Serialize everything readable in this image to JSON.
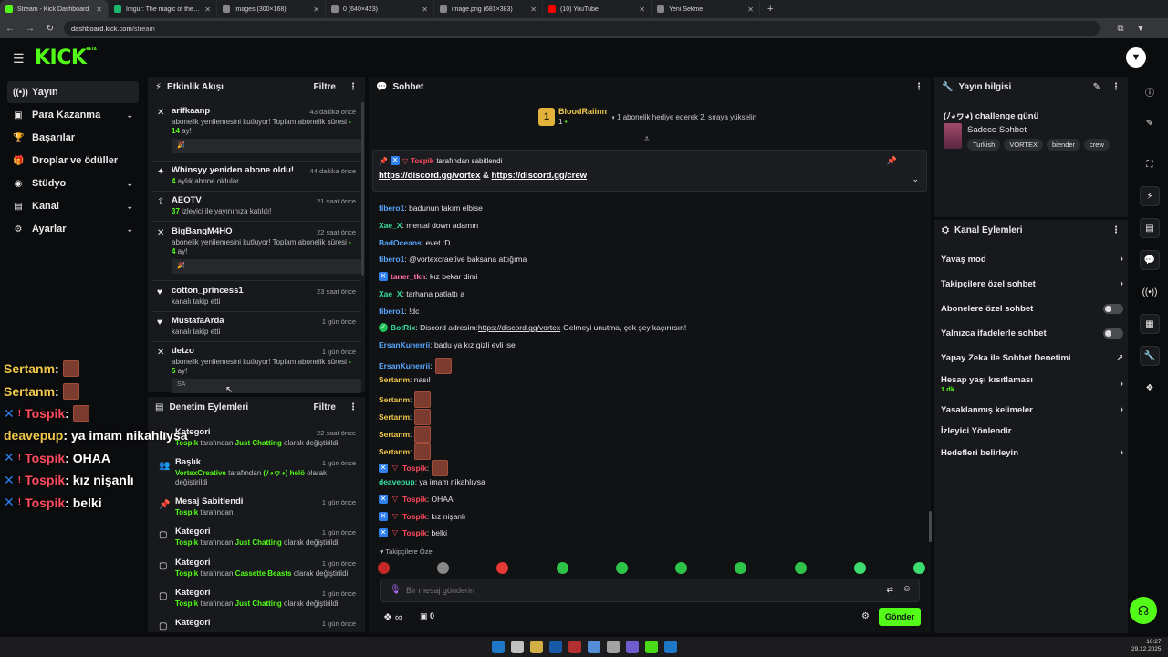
{
  "browser": {
    "tabs": [
      {
        "title": "Stream - Kick Dashboard",
        "color": "#53fc18",
        "active": true
      },
      {
        "title": "Imgur: The magic of the Internet",
        "color": "#1bb76e"
      },
      {
        "title": "images (300×168)",
        "color": "#888"
      },
      {
        "title": "0 (640×423)",
        "color": "#888"
      },
      {
        "title": "image.png (681×383)",
        "color": "#888"
      },
      {
        "title": "(10) YouTube",
        "color": "#ff0000"
      },
      {
        "title": "Yeni Sekme",
        "color": "#888"
      }
    ],
    "new_tab": "+",
    "url_host": "dashboard.kick.com",
    "url_path": "/stream"
  },
  "header": {
    "logo": "KICK",
    "logo_sup": "BETA"
  },
  "sidebar": {
    "items": [
      {
        "label": "Yayın",
        "icon": "broadcast-icon",
        "glyph": "((•))",
        "active": true
      },
      {
        "label": "Para Kazanma",
        "icon": "wallet-icon",
        "glyph": "▣",
        "chev": true
      },
      {
        "label": "Başarılar",
        "icon": "trophy-icon",
        "glyph": "🏆"
      },
      {
        "label": "Droplar ve ödüller",
        "icon": "gift-icon",
        "glyph": "🎁"
      },
      {
        "label": "Stüdyo",
        "icon": "studio-icon",
        "glyph": "◉",
        "chev": true
      },
      {
        "label": "Kanal",
        "icon": "channel-icon",
        "glyph": "▤",
        "chev": true
      },
      {
        "label": "Ayarlar",
        "icon": "gear-icon",
        "glyph": "⚙",
        "chev": true
      }
    ]
  },
  "activity": {
    "title": "Etkinlik Akışı",
    "filter": "Filtre",
    "events": [
      {
        "name": "arifkaanp",
        "time": "43 dakika önce",
        "text": "abonelik yenilemesini kutluyor! Toplam abonelik süresi",
        "hl": "- 14",
        "tail": " ay!",
        "quote": "🎉",
        "icon": "renew-icon",
        "g": "✕"
      },
      {
        "name": "Whinsyy yeniden abone oldu!",
        "time": "44 dakika önce",
        "hl": "4",
        "text": " aylık abone oldular",
        "icon": "sparkle-icon",
        "g": "✦"
      },
      {
        "name": "AEOTV",
        "time": "21 saat önce",
        "hl": "37",
        "text": " izleyici ile yayınınıza katıldı!",
        "icon": "raid-icon",
        "g": "⇪"
      },
      {
        "name": "BigBangM4HO",
        "time": "22 saat önce",
        "text": "abonelik yenilemesini kutluyor! Toplam abonelik süresi",
        "hl": "- 4",
        "tail": " ay!",
        "quote": "🎉",
        "icon": "renew-icon",
        "g": "✕"
      },
      {
        "name": "cotton_princess1",
        "time": "23 saat önce",
        "text": "kanalı takip etti",
        "icon": "heart-icon",
        "g": "♥"
      },
      {
        "name": "MustafaArda",
        "time": "1 gün önce",
        "text": "kanalı takip etti",
        "icon": "heart-icon",
        "g": "♥"
      },
      {
        "name": "detzo",
        "time": "1 gün önce",
        "text": "abonelik yenilemesini kutluyor! Toplam abonelik süresi",
        "hl": "- 5",
        "tail": " ay!",
        "quote": "SA",
        "icon": "renew-icon",
        "g": "✕"
      }
    ]
  },
  "moderation": {
    "title": "Denetim Eylemleri",
    "filter": "Filtre",
    "items": [
      {
        "title": "Kategori",
        "time": "22 saat önce",
        "who": "Tospik",
        "mid": " tarafından ",
        "target": "Just Chatting",
        "end": " olarak değiştirildi",
        "icon": "category-icon",
        "g": "▢"
      },
      {
        "title": "Başlık",
        "time": "1 gün önce",
        "who": "VortexCreative",
        "mid": " tarafından ",
        "target": "(ﾉ◕ヮ◕) helö",
        "end": " olarak değiştirildi",
        "icon": "users-icon",
        "g": "👥"
      },
      {
        "title": "Mesaj Sabitlendi",
        "time": "1 gün önce",
        "who": "Tospik",
        "mid": " tarafından",
        "target": "",
        "end": "",
        "icon": "pin-icon",
        "g": "📌"
      },
      {
        "title": "Kategori",
        "time": "1 gün önce",
        "who": "Tospik",
        "mid": " tarafından ",
        "target": "Just Chatting",
        "end": " olarak değiştirildi",
        "icon": "category-icon",
        "g": "▢"
      },
      {
        "title": "Kategori",
        "time": "1 gün önce",
        "who": "Tospik",
        "mid": " tarafından ",
        "target": "Cassette Beasts",
        "end": " olarak değiştirildi",
        "icon": "category-icon",
        "g": "▢"
      },
      {
        "title": "Kategori",
        "time": "1 gün önce",
        "who": "Tospik",
        "mid": " tarafından ",
        "target": "Just Chatting",
        "end": " olarak değiştirildi",
        "icon": "category-icon",
        "g": "▢"
      },
      {
        "title": "Kategori",
        "time": "1 gün önce",
        "who": "",
        "mid": "",
        "target": "",
        "end": "",
        "icon": "category-icon",
        "g": "▢"
      }
    ]
  },
  "chat": {
    "title": "Sohbet",
    "gift": {
      "rank": "1",
      "user": "BloodRaiinn",
      "count": "1",
      "text": "1 abonelik hediye ederek 2. sıraya yükselin"
    },
    "pinned": {
      "by": "Tospik",
      "by_text": " tarafından sabitlendi",
      "link1": "https://discord.gg/vortex",
      "amp": " & ",
      "link2": "https://discord.gg/crew"
    },
    "messages": [
      {
        "user": "fibero1",
        "color": "blue",
        "text": ": badunun takım elbise"
      },
      {
        "user": "Xae_X",
        "color": "teal",
        "text": ": mental down adamın"
      },
      {
        "user": "BadOceans",
        "color": "blue",
        "text": ": evet :D"
      },
      {
        "user": "fibero1",
        "color": "blue",
        "text": ": @vortexcraetive baksana attığıma"
      },
      {
        "user": "taner_tkn",
        "color": "pink",
        "text": ": kız bekar dimi",
        "badges": [
          "✕ "
        ]
      },
      {
        "user": "Xae_X",
        "color": "teal",
        "text": ": tarhana patlattı a"
      },
      {
        "user": "fibero1",
        "color": "blue",
        "text": ": !dc"
      },
      {
        "user": "BotRix",
        "color": "teal",
        "text": ": Discord adresim: ",
        "link": "https://discord.gg/vortex",
        "after": " Gelmeyi unutma, çok şey kaçırırsın!",
        "badges": [
          "✓"
        ]
      },
      {
        "user": "ErsanKunerrii",
        "color": "blue",
        "text": ": badu ya kız gizli evli ise"
      },
      {
        "user": "ErsanKunerrii",
        "color": "blue",
        "text": ":",
        "emote": true
      },
      {
        "user": "Sertanm",
        "color": "yel",
        "text": ": nasıl"
      },
      {
        "user": "Sertanm",
        "color": "yel",
        "text": ":",
        "emote": true
      },
      {
        "user": "Sertanm",
        "color": "yel",
        "text": ":",
        "emote": true
      },
      {
        "user": "Sertanm",
        "color": "yel",
        "text": ":",
        "emote": true
      },
      {
        "user": "Sertanm",
        "color": "yel",
        "text": ":",
        "emote": true
      },
      {
        "user": "Tospik",
        "color": "red",
        "text": ":",
        "emote": true,
        "badges": [
          "✕",
          "▽"
        ]
      },
      {
        "user": "deavepup",
        "color": "teal",
        "text": ": ya imam nikahlıysa"
      },
      {
        "user": "Tospik",
        "color": "red",
        "text": ": OHAA",
        "badges": [
          "✕",
          "▽"
        ]
      },
      {
        "user": "Tospik",
        "color": "red",
        "text": ": kız nişanlı",
        "badges": [
          "✕",
          "▽"
        ]
      },
      {
        "user": "Tospik",
        "color": "red",
        "text": ": belki",
        "badges": [
          "✕",
          "▽"
        ]
      }
    ],
    "followers_only": "♥ Takipçilere Özel",
    "placeholder": "Bir mesaj gönderin",
    "send": "Gönder",
    "points": "0"
  },
  "overlay": [
    {
      "user": "Sertanm",
      "text": ":",
      "emote": true,
      "color": "#f2c94c"
    },
    {
      "user": "Sertanm",
      "text": ":",
      "emote": true,
      "color": "#f2c94c"
    },
    {
      "user": "Tospik",
      "text": ":",
      "emote": true,
      "color": "#ff4d5e",
      "badges": true
    },
    {
      "user": "deavepup",
      "text": ": ya imam nikahlıysa",
      "color": "#f2c94c"
    },
    {
      "user": "Tospik",
      "text": ": OHAA",
      "color": "#ff4d5e",
      "badges": true
    },
    {
      "user": "Tospik",
      "text": ": kız nişanlı",
      "color": "#ff4d5e",
      "badges": true
    },
    {
      "user": "Tospik",
      "text": ": belki",
      "color": "#ff4d5e",
      "badges": true
    }
  ],
  "stream_info": {
    "title": "Yayın bilgisi",
    "stream_title": "(ﾉ◕ヮ◕) challenge günü",
    "category": "Sadece Sohbet",
    "tags": [
      "Turkish",
      "VORTEX",
      "biender",
      "crew"
    ]
  },
  "channel_actions": {
    "title": "Kanal Eylemleri",
    "items": [
      {
        "label": "Yavaş mod",
        "type": "chev"
      },
      {
        "label": "Takipçilere özel sohbet",
        "type": "chev"
      },
      {
        "label": "Abonelere özel sohbet",
        "type": "toggle"
      },
      {
        "label": "Yalnızca ifadelerle sohbet",
        "type": "toggle"
      },
      {
        "label": "Yapay Zeka ile Sohbet Denetimi",
        "type": "ext"
      },
      {
        "label": "Hesap yaşı kısıtlaması",
        "sub": "1 dk.",
        "type": "chev"
      },
      {
        "label": "Yasaklanmış kelimeler",
        "type": "chev"
      },
      {
        "label": "İzleyici Yönlendir",
        "type": "none"
      },
      {
        "label": "Hedefleri belirleyin",
        "type": "chev"
      }
    ]
  },
  "taskbar": {
    "time": "16:27",
    "date": "29.12.2025"
  },
  "colors": {
    "accent": "#53fc18",
    "bg": "#0b0c0e",
    "panel": "#18191c"
  }
}
